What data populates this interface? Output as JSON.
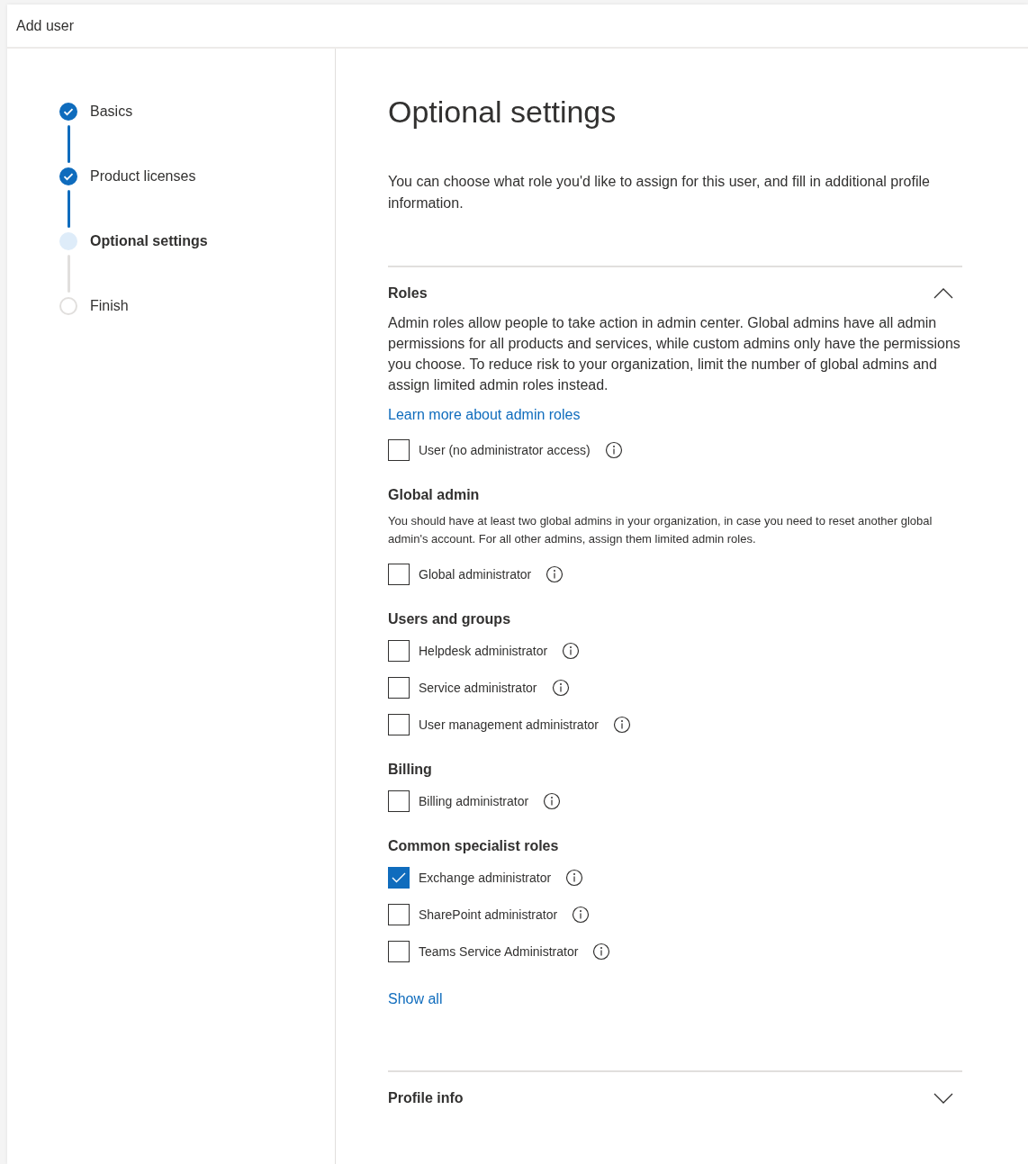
{
  "header": {
    "title": "Add user"
  },
  "steps": [
    {
      "label": "Basics",
      "completed": true,
      "selected": false
    },
    {
      "label": "Product licenses",
      "completed": true,
      "selected": false
    },
    {
      "label": "Optional settings",
      "completed": false,
      "selected": true
    },
    {
      "label": "Finish",
      "completed": false,
      "selected": false
    }
  ],
  "page": {
    "title": "Optional settings",
    "description": "You can choose what role you'd like to assign for this user, and fill in additional profile information."
  },
  "sections": [
    {
      "title": "Roles",
      "expanded": true,
      "description": "Admin roles allow people to take action in admin center. Global admins have all admin permissions for all products and services, while custom admins only have the permissions you choose. To reduce risk to your organization, limit the number of global admins and assign limited admin roles instead.",
      "link": "Learn more about admin roles",
      "groups": [
        {
          "roles": [
            {
              "label": "User (no administrator access)",
              "checked": false
            }
          ]
        },
        {
          "title": "Global admin",
          "description": "You should have at least two global admins in your organization, in case you need to reset another global admin's account. For all other admins, assign them limited admin roles.",
          "roles": [
            {
              "label": "Global administrator",
              "checked": false
            }
          ]
        },
        {
          "title": "Users and groups",
          "roles": [
            {
              "label": "Helpdesk administrator",
              "checked": false
            },
            {
              "label": "Service administrator",
              "checked": false
            },
            {
              "label": "User management administrator",
              "checked": false
            }
          ]
        },
        {
          "title": "Billing",
          "roles": [
            {
              "label": "Billing administrator",
              "checked": false
            }
          ]
        },
        {
          "title": "Common specialist roles",
          "roles": [
            {
              "label": "Exchange administrator",
              "checked": true
            },
            {
              "label": "SharePoint administrator",
              "checked": false
            },
            {
              "label": "Teams Service Administrator",
              "checked": false
            }
          ]
        }
      ],
      "show_all": "Show all"
    },
    {
      "title": "Profile info",
      "expanded": false
    }
  ]
}
